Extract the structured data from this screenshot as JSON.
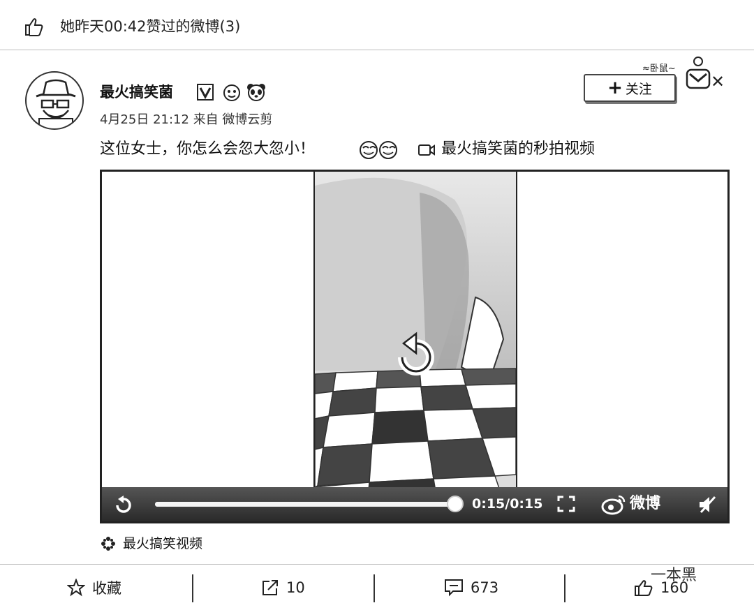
{
  "header": {
    "liked_text": "她昨天00:42赞过的微博(3)"
  },
  "post": {
    "author": "最火搞笑菌",
    "follow_label": "关注",
    "time": "4月25日 21:12",
    "from_label": "来自",
    "source_app": "微博云剪",
    "text": "这位女士，你怎么会忽大忽小！",
    "video_link": "最火搞笑菌的秒拍视频",
    "video_source": "最火搞笑视频"
  },
  "video": {
    "time_display": "0:15/0:15",
    "progress": 1.0,
    "brand": "微博"
  },
  "actions": {
    "favorite_label": "收藏",
    "repost_count": "10",
    "comment_count": "673",
    "like_count": "160"
  },
  "watermark": "一本黑"
}
